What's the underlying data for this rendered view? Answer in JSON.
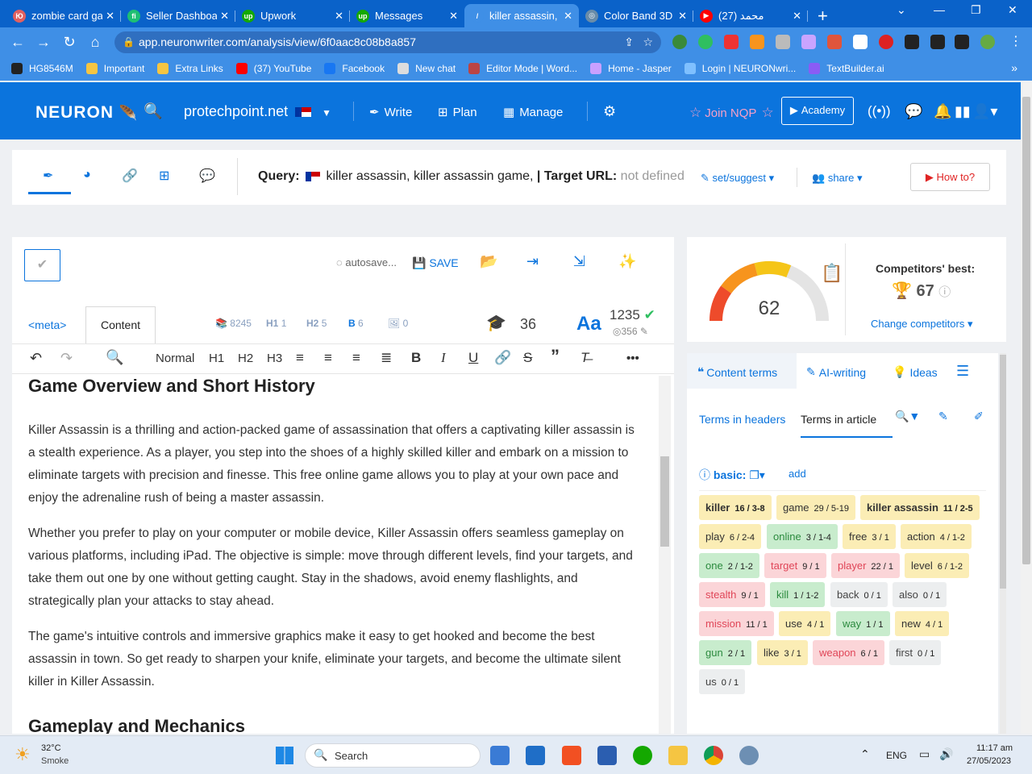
{
  "browser": {
    "tabs": [
      {
        "label": "zombie card ga",
        "color": "#e06060",
        "glyph": "Ю"
      },
      {
        "label": "Seller Dashboa",
        "color": "#1dbf73",
        "glyph": "fi"
      },
      {
        "label": "Upwork",
        "color": "#14a800",
        "glyph": "up"
      },
      {
        "label": "Messages",
        "color": "#14a800",
        "glyph": "up"
      },
      {
        "label": "killer assassin, ",
        "color": "#3f8fe6",
        "glyph": "/"
      },
      {
        "label": "Color Band 3D",
        "color": "#6a8ca8",
        "glyph": "◎"
      },
      {
        "label": "محمد (27)",
        "color": "#ff0000",
        "glyph": "▶"
      }
    ],
    "close_glyph": "✕",
    "new_tab_glyph": "+",
    "url": "app.neuronwriter.com/analysis/view/6f0aac8c08b8a857",
    "bookmarks": [
      {
        "label": "HG8546M",
        "color": "#222222"
      },
      {
        "label": "Important",
        "color": "#f5c542"
      },
      {
        "label": "Extra Links",
        "color": "#f5c542"
      },
      {
        "label": "(37) YouTube",
        "color": "#ff0000"
      },
      {
        "label": "Facebook",
        "color": "#1877f2"
      },
      {
        "label": "New chat",
        "color": "#dddddd"
      },
      {
        "label": "Editor Mode | Word...",
        "color": "#b44"
      },
      {
        "label": "Home - Jasper",
        "color": "#c9a0ff"
      },
      {
        "label": "Login | NEURONwri...",
        "color": "#7fc0ff"
      },
      {
        "label": "TextBuilder.ai",
        "color": "#8a5cf5"
      }
    ],
    "more_glyph": "»"
  },
  "app": {
    "logo": "NEURON",
    "site": "protechpoint.net",
    "nav": {
      "write": "Write",
      "plan": "Plan",
      "manage": "Manage"
    },
    "join": "Join NQP",
    "academy": "Academy"
  },
  "query": {
    "label": "Query:",
    "value": "killer assassin, killer assassin game,",
    "target_label": "| Target URL:",
    "target_value": "not defined",
    "set_suggest": "set/suggest",
    "share": "share",
    "how_to": "How to?"
  },
  "editor": {
    "autosave": "autosave...",
    "save": "SAVE",
    "tab_meta": "<meta>",
    "tab_content": "Content",
    "stats": {
      "words": "8245",
      "h1": "1",
      "h2": "5",
      "b": "6",
      "img": "0"
    },
    "h1_label": "H1",
    "h2_label": "H2",
    "b_label": "B",
    "grade": "36",
    "aa": "Aa",
    "word_count": "1235",
    "sub_count": "356",
    "toolbar": {
      "normal": "Normal",
      "h1": "H1",
      "h2": "H2",
      "h3": "H3",
      "more": "•••"
    },
    "heading": "Game Overview and Short History",
    "paragraphs": [
      "Killer Assassin is a thrilling and action-packed game of assassination that offers a captivating killer assassin is a stealth experience. As a player, you step into the shoes of a highly skilled killer and embark on a mission to eliminate targets with precision and finesse. This free online game allows you to play at your own pace and enjoy the adrenaline rush of being a master assassin.",
      "Whether you prefer to play on your computer or mobile device, Killer Assassin offers seamless gameplay on various platforms, including iPad. The objective is simple: move through different levels, find your targets, and take them out one by one without getting caught. Stay in the shadows, avoid enemy flashlights, and strategically plan your attacks to stay ahead.",
      "The game's intuitive controls and immersive graphics make it easy to get hooked and become the best assassin in town. So get ready to sharpen your knife, eliminate your targets, and become the ultimate silent killer in Killer Assassin."
    ],
    "next_heading": "Gameplay and Mechanics"
  },
  "score": {
    "value": 62,
    "gauge_fraction": 0.62,
    "competitors_label": "Competitors' best:",
    "competitors_value": "67",
    "change_competitors": "Change competitors"
  },
  "terms_panel": {
    "tabs": {
      "content_terms": "Content terms",
      "ai_writing": "AI-writing",
      "ideas": "Ideas"
    },
    "sub_tabs": {
      "headers": "Terms in headers",
      "article": "Terms in article"
    },
    "basic_label": "basic:",
    "add_label": "add",
    "terms": [
      {
        "term": "killer",
        "count": "16 / 3-8",
        "style": "ybold"
      },
      {
        "term": "game",
        "count": "29 / 5-19",
        "style": "y"
      },
      {
        "term": "killer assassin",
        "count": "11 / 2-5",
        "style": "ybold"
      },
      {
        "term": "play",
        "count": "6 / 2-4",
        "style": "y"
      },
      {
        "term": "online",
        "count": "3 / 1-4",
        "style": "g"
      },
      {
        "term": "free",
        "count": "3 / 1",
        "style": "y"
      },
      {
        "term": "action",
        "count": "4 / 1-2",
        "style": "y"
      },
      {
        "term": "one",
        "count": "2 / 1-2",
        "style": "g"
      },
      {
        "term": "target",
        "count": "9 / 1",
        "style": "r"
      },
      {
        "term": "player",
        "count": "22 / 1",
        "style": "r"
      },
      {
        "term": "level",
        "count": "6 / 1-2",
        "style": "y"
      },
      {
        "term": "stealth",
        "count": "9 / 1",
        "style": "r"
      },
      {
        "term": "kill",
        "count": "1 / 1-2",
        "style": "g"
      },
      {
        "term": "back",
        "count": "0 / 1",
        "style": "gr"
      },
      {
        "term": "also",
        "count": "0 / 1",
        "style": "gr"
      },
      {
        "term": "mission",
        "count": "11 / 1",
        "style": "r"
      },
      {
        "term": "use",
        "count": "4 / 1",
        "style": "y"
      },
      {
        "term": "way",
        "count": "1 / 1",
        "style": "g"
      },
      {
        "term": "new",
        "count": "4 / 1",
        "style": "y"
      },
      {
        "term": "gun",
        "count": "2 / 1",
        "style": "g"
      },
      {
        "term": "like",
        "count": "3 / 1",
        "style": "y"
      },
      {
        "term": "weapon",
        "count": "6 / 1",
        "style": "r"
      },
      {
        "term": "first",
        "count": "0 / 1",
        "style": "gr"
      },
      {
        "term": "us",
        "count": "0 / 1",
        "style": "gr"
      }
    ]
  },
  "taskbar": {
    "weather_temp": "32°C",
    "weather_desc": "Smoke",
    "search": "Search",
    "lang": "ENG",
    "time": "11:17 am",
    "date": "27/05/2023"
  }
}
